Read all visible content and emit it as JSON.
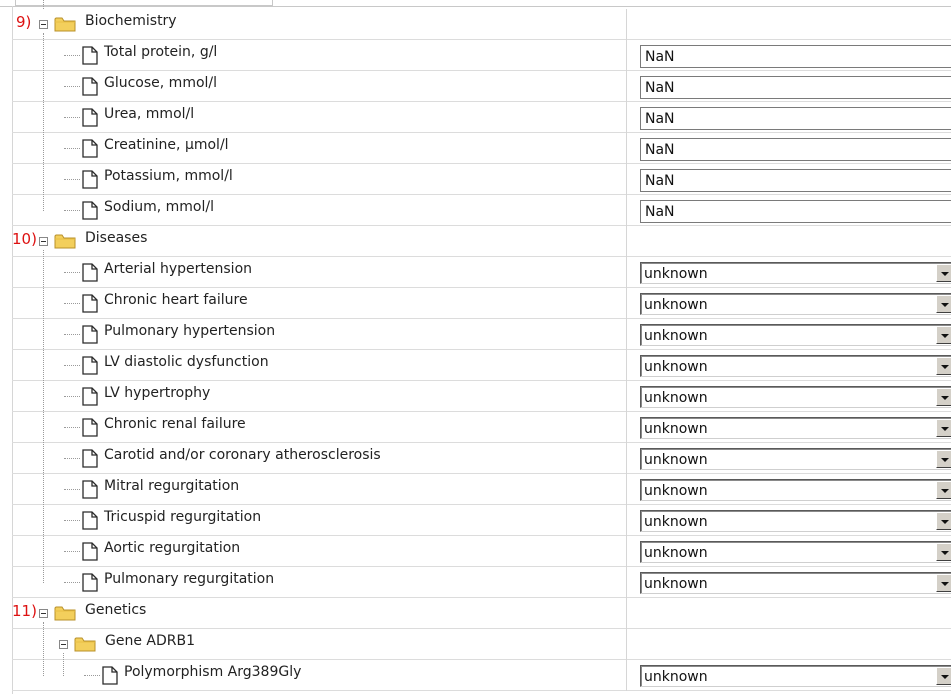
{
  "sections": [
    {
      "number": "9)",
      "label": "Biochemistry",
      "items": [
        {
          "label": "Total protein, g/l",
          "value": "NaN"
        },
        {
          "label": "Glucose, mmol/l",
          "value": "NaN"
        },
        {
          "label": "Urea, mmol/l",
          "value": "NaN"
        },
        {
          "label": "Creatinine, μmol/l",
          "value": "NaN"
        },
        {
          "label": "Potassium, mmol/l",
          "value": "NaN"
        },
        {
          "label": "Sodium, mmol/l",
          "value": "NaN"
        }
      ]
    },
    {
      "number": "10)",
      "label": "Diseases",
      "items": [
        {
          "label": "Arterial hypertension",
          "value": "unknown"
        },
        {
          "label": "Chronic heart failure",
          "value": "unknown"
        },
        {
          "label": "Pulmonary hypertension",
          "value": "unknown"
        },
        {
          "label": "LV diastolic dysfunction",
          "value": "unknown"
        },
        {
          "label": "LV hypertrophy",
          "value": "unknown"
        },
        {
          "label": "Chronic renal failure",
          "value": "unknown"
        },
        {
          "label": "Carotid and/or coronary atherosclerosis",
          "value": "unknown"
        },
        {
          "label": "Mitral regurgitation",
          "value": "unknown"
        },
        {
          "label": "Tricuspid regurgitation",
          "value": "unknown"
        },
        {
          "label": "Aortic regurgitation",
          "value": "unknown"
        },
        {
          "label": "Pulmonary regurgitation",
          "value": "unknown"
        }
      ]
    },
    {
      "number": "11)",
      "label": "Genetics",
      "subgroup": {
        "label": "Gene ADRB1",
        "items": [
          {
            "label": "Polymorphism Arg389Gly",
            "value": "unknown"
          }
        ]
      }
    }
  ],
  "colors": {
    "section_number": "#dd1111",
    "folder": "#f3cf5c",
    "grid_line": "#dcdcdc"
  },
  "icons": {
    "collapse": "minus-box-icon",
    "folder": "folder-icon",
    "document": "document-icon",
    "dropdown": "dropdown-arrow-icon"
  }
}
